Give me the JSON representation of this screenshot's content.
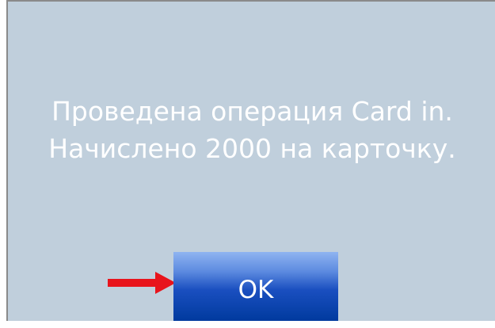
{
  "dialog": {
    "message_line1": "Проведена операция Card in.",
    "message_line2": "Начислено 2000 на карточку.",
    "ok_label": "OK"
  },
  "annotation": {
    "arrow_icon": "red-arrow-right-icon",
    "arrow_color": "#e8141c"
  },
  "colors": {
    "dialog_background": "#c0cfdc",
    "button_top": "#8fb4f0",
    "button_bottom": "#003a9e",
    "text": "#ffffff"
  }
}
